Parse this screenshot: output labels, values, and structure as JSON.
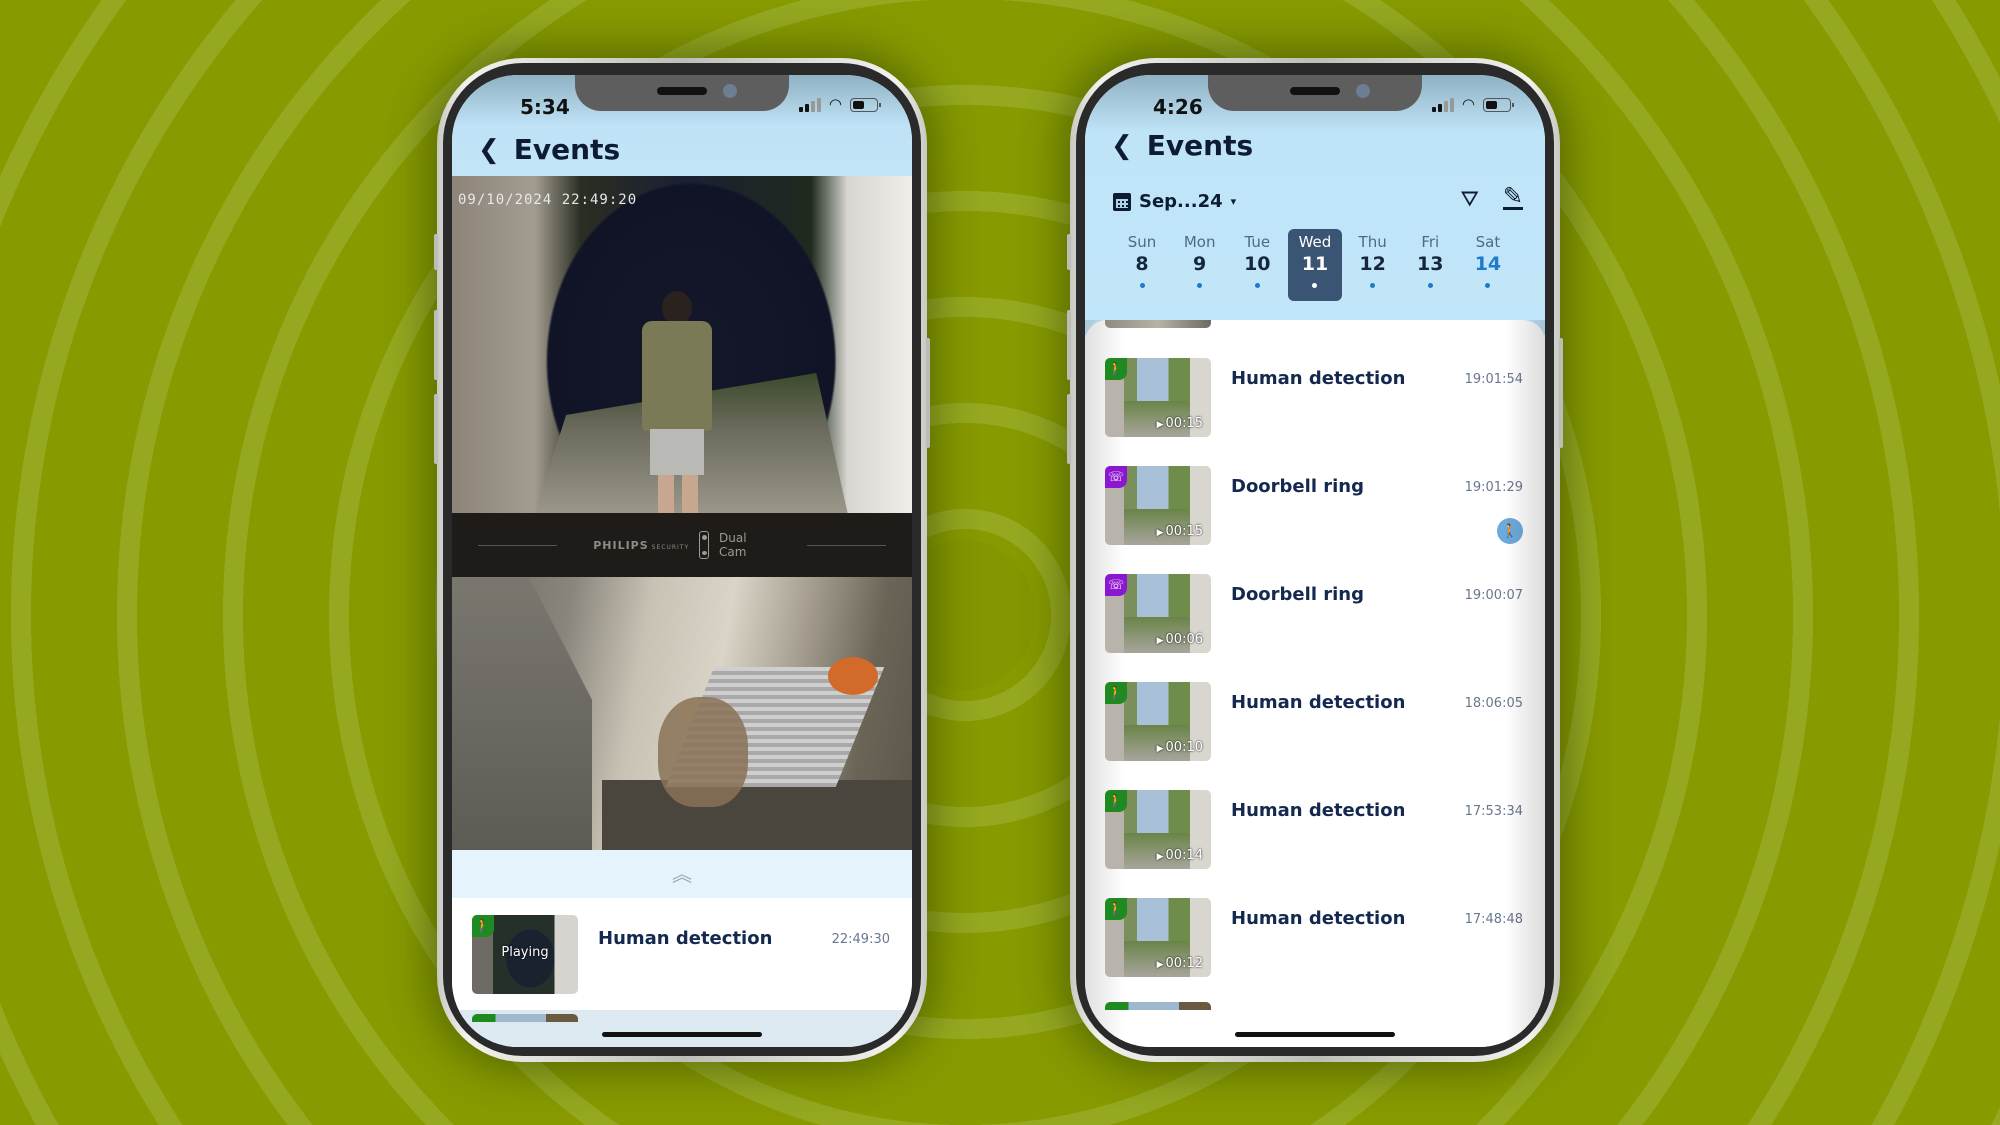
{
  "left_phone": {
    "status": {
      "time": "5:34"
    },
    "nav": {
      "back_label": "Events"
    },
    "video": {
      "timestamp": "09/10/2024 22:49:20",
      "brand": "PHILIPS",
      "brand_sub": "SECURITY",
      "device": "Dual Cam"
    },
    "collapse_icon": "︽",
    "events": [
      {
        "type": "human",
        "badge_icon": "walking-person-icon",
        "thumb_label": "Playing",
        "title": "Human detection",
        "time": "22:49:30"
      }
    ]
  },
  "right_phone": {
    "status": {
      "time": "4:26"
    },
    "nav": {
      "back_label": "Events"
    },
    "date_selector": {
      "label": "Sep...24",
      "caret": "▾"
    },
    "actions": {
      "filter_icon": "filter-icon",
      "edit_icon": "edit-icon"
    },
    "week": [
      {
        "name": "Sun",
        "date": "8",
        "selected": false
      },
      {
        "name": "Mon",
        "date": "9",
        "selected": false
      },
      {
        "name": "Tue",
        "date": "10",
        "selected": false
      },
      {
        "name": "Wed",
        "date": "11",
        "selected": true
      },
      {
        "name": "Thu",
        "date": "12",
        "selected": false
      },
      {
        "name": "Fri",
        "date": "13",
        "selected": false
      },
      {
        "name": "Sat",
        "date": "14",
        "selected": false,
        "today": true
      }
    ],
    "events": [
      {
        "type": "human",
        "title": "Human detection",
        "time": "19:01:54",
        "duration": "00:15"
      },
      {
        "type": "ring",
        "title": "Doorbell ring",
        "time": "19:01:29",
        "duration": "00:15",
        "extra_badge": "human"
      },
      {
        "type": "ring",
        "title": "Doorbell ring",
        "time": "19:00:07",
        "duration": "00:06"
      },
      {
        "type": "human",
        "title": "Human detection",
        "time": "18:06:05",
        "duration": "00:10"
      },
      {
        "type": "human",
        "title": "Human detection",
        "time": "17:53:34",
        "duration": "00:14"
      },
      {
        "type": "human",
        "title": "Human detection",
        "time": "17:48:48",
        "duration": "00:12"
      }
    ]
  },
  "colors": {
    "background": "#879a00",
    "header_blue": "#c2e6f9",
    "title_navy": "#142850",
    "human_badge": "#1f8a1f",
    "ring_badge": "#8c17d1",
    "selected_day": "#3a5473",
    "accent_blue": "#1e78cc"
  }
}
